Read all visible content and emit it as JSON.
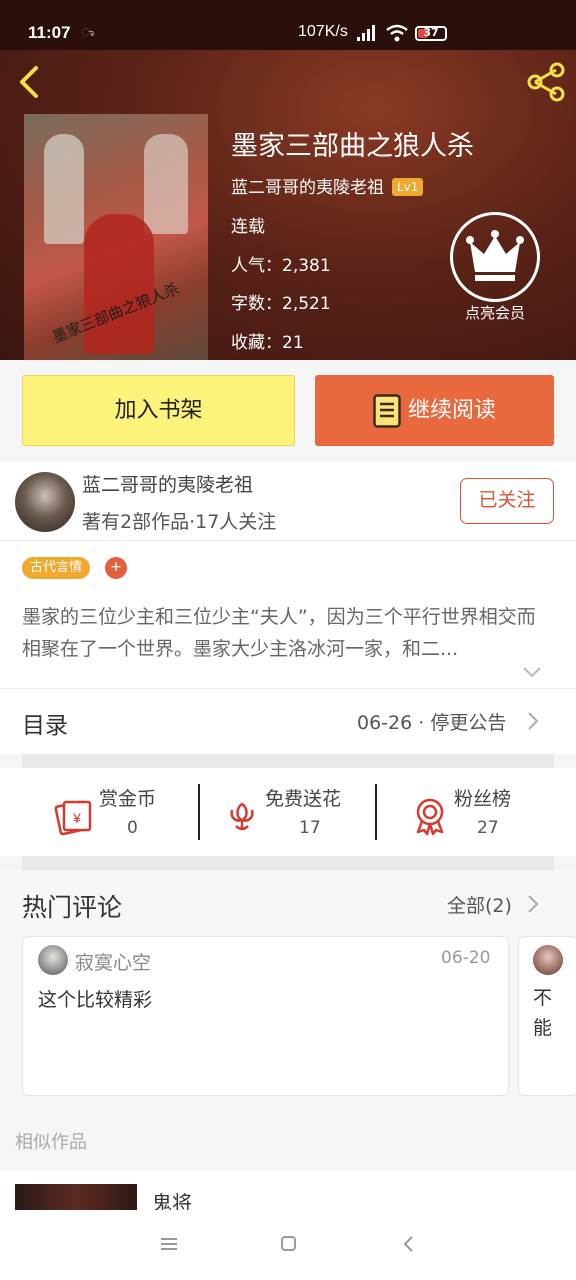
{
  "status_bar": {
    "time": "11:07",
    "net_speed": "107K/s",
    "battery": "37",
    "notif": "ಾ"
  },
  "book": {
    "title": "墨家三部曲之狼人杀",
    "author": "蓝二哥哥的夷陵老祖",
    "level": "Lv1",
    "status": "连载",
    "popularity": "人气：2,381",
    "word_count": "字数：2,521",
    "favorites": "收藏：21",
    "cover_text": "墨家三部曲之狼人杀"
  },
  "vip": {
    "label": "点亮会员"
  },
  "actions": {
    "add_shelf": "加入书架",
    "continue_read": "继续阅读"
  },
  "author_card": {
    "name": "蓝二哥哥的夷陵老祖",
    "meta": "著有2部作品·17人关注",
    "follow": "已关注"
  },
  "tags": {
    "genre": "古代言情",
    "add": "+"
  },
  "intro": {
    "text": "墨家的三位少主和三位少主“夫人”，因为三个平行世界相交而相聚在了一个世界。墨家大少主洛冰河一家，和二..."
  },
  "toc": {
    "title": "目录",
    "update": "06-26 · 停更公告"
  },
  "stats": [
    {
      "label": "赏金币",
      "value": "0",
      "icon": "red-envelope-icon"
    },
    {
      "label": "免费送花",
      "value": "17",
      "icon": "flower-icon"
    },
    {
      "label": "粉丝榜",
      "value": "27",
      "icon": "medal-icon"
    }
  ],
  "comments": {
    "title": "热门评论",
    "all": "全部(2)",
    "items": [
      {
        "user": "寂寞心空",
        "date": "06-20",
        "text": "这个比较精彩"
      },
      {
        "user": "",
        "date": "",
        "text": "不能"
      }
    ]
  },
  "similar": {
    "label": "相似作品",
    "first_title": "鬼将"
  },
  "colors": {
    "accent_orange": "#e8693e",
    "shelf_yellow": "#fdf27a",
    "tag_orange": "#f0a92e",
    "follow_red": "#d9543b"
  }
}
